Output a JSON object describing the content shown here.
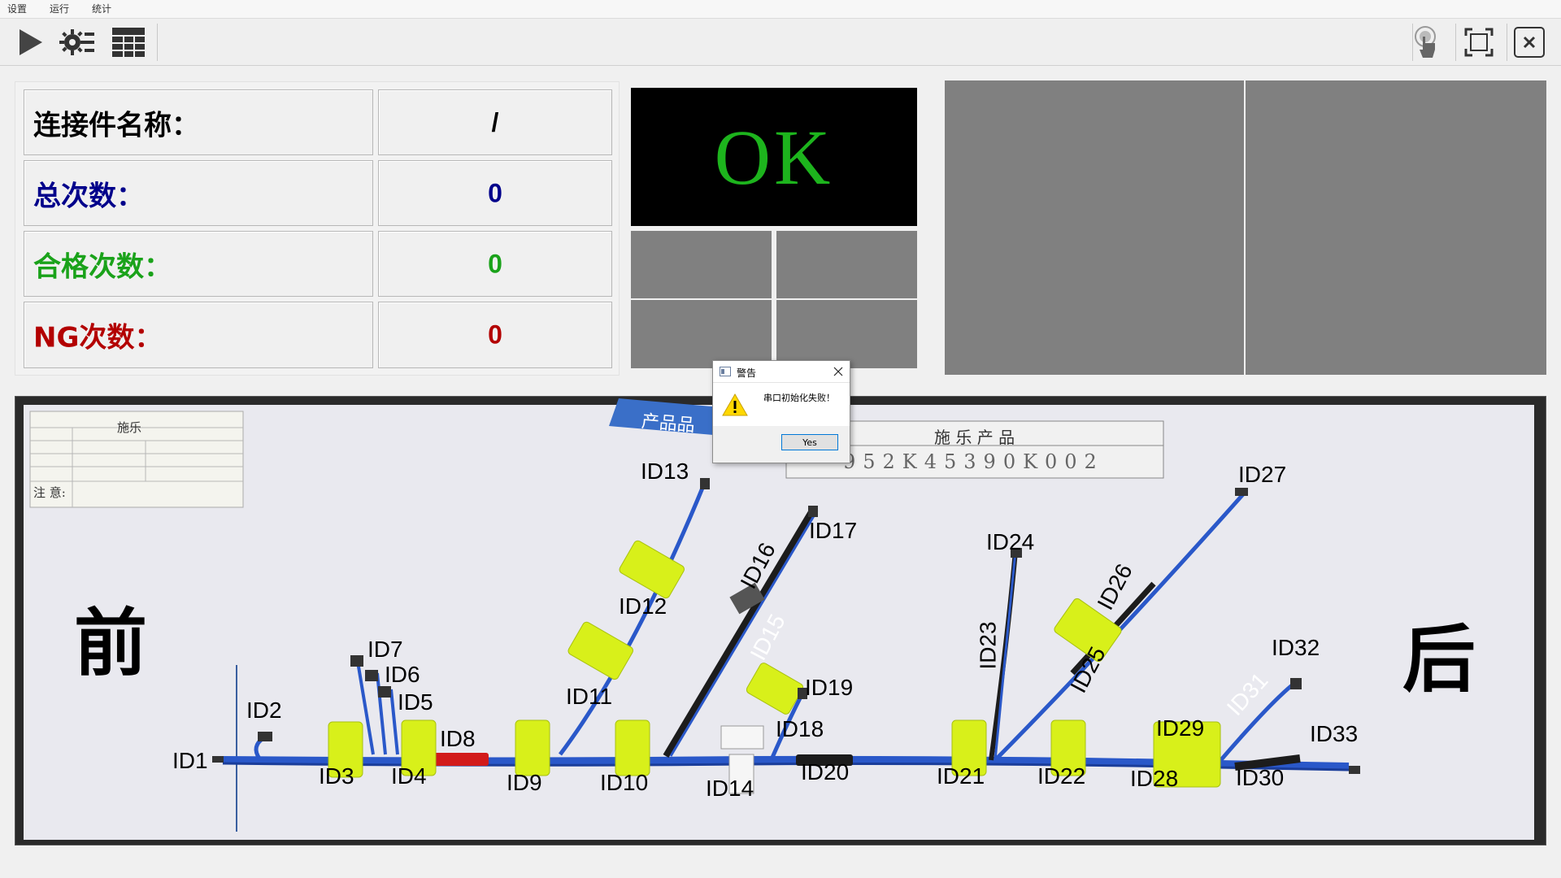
{
  "menu": [
    "设置",
    "运行",
    "统计"
  ],
  "toolbar": {
    "icons": [
      "play-icon",
      "settings-icon",
      "grid-icon",
      "touch-icon",
      "fullscreen-icon",
      "close-icon"
    ]
  },
  "stats": {
    "name_label": "连接件名称：",
    "name_value": "/",
    "total_label": "总次数：",
    "total_value": "0",
    "pass_label": "合格次数：",
    "pass_value": "0",
    "ng_label": "NG次数：",
    "ng_value": "0"
  },
  "colors": {
    "name": "#000000",
    "total": "#00008b",
    "pass": "#1aa21a",
    "ng": "#b30000",
    "ok_text": "#1db41d"
  },
  "status": {
    "text": "OK"
  },
  "board": {
    "left_label": "前",
    "right_label": "后",
    "product_tag": "产品品",
    "card_title": "施 乐 产 品",
    "card_code": "952K45390K002",
    "small_label_title": "施乐",
    "small_label_note": "注 意:",
    "ids": [
      "ID1",
      "ID2",
      "ID3",
      "ID4",
      "ID5",
      "ID6",
      "ID7",
      "ID8",
      "ID9",
      "ID10",
      "ID11",
      "ID12",
      "ID13",
      "ID14",
      "ID15",
      "ID16",
      "ID17",
      "ID18",
      "ID19",
      "ID20",
      "ID21",
      "ID22",
      "ID23",
      "ID24",
      "ID25",
      "ID26",
      "ID27",
      "ID28",
      "ID29",
      "ID30",
      "ID31",
      "ID32",
      "ID33"
    ]
  },
  "dialog": {
    "title": "警告",
    "message": "串口初始化失败！",
    "yes": "Yes"
  }
}
